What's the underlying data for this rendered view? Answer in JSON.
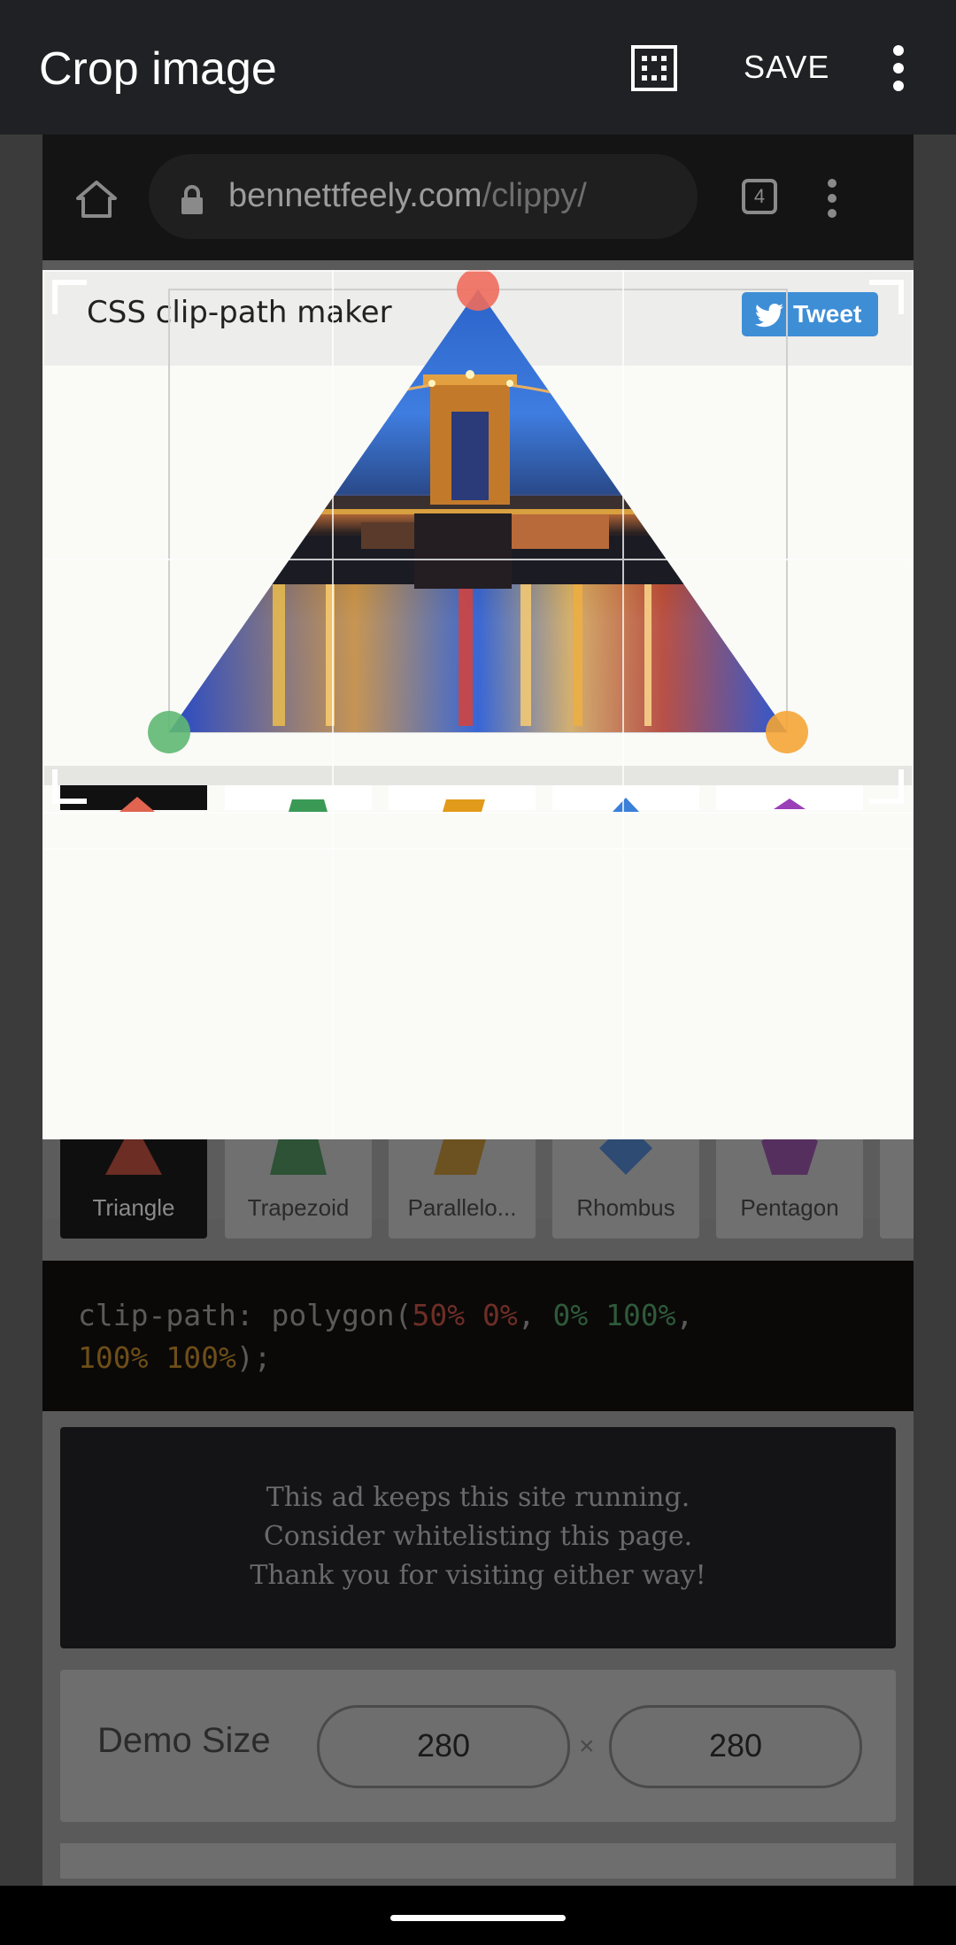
{
  "app_bar": {
    "title": "Crop image",
    "aspect_icon": "aspect-ratio-grid-icon",
    "save_label": "SAVE",
    "more_icon": "more-vert-icon"
  },
  "browser": {
    "home_icon": "home-icon",
    "lock_icon": "lock-icon",
    "url_host": "bennettfeely.com",
    "url_path": "/clippy/",
    "tab_count": "4",
    "menu_icon": "more-vert-icon"
  },
  "page": {
    "title": "CSS clip-path maker",
    "tweet_label": "Tweet",
    "shapes": [
      {
        "label": "Triangle",
        "color": "#e0644f",
        "active": true
      },
      {
        "label": "Trapezoid",
        "color": "#3a9a55"
      },
      {
        "label": "Parallelo...",
        "color": "#e29a1a"
      },
      {
        "label": "Rhombus",
        "color": "#3a7fd8"
      },
      {
        "label": "Pentagon",
        "color": "#9a3fb8"
      }
    ],
    "code": {
      "prefix": "clip-path: polygon(",
      "p1": "50% 0%",
      "sep1": ", ",
      "p2": "0% 100%",
      "sep2": ",",
      "p3": "100% 100%",
      "suffix": ");"
    },
    "ad_lines": [
      "This ad keeps this site running.",
      "Consider whitelisting this page.",
      "Thank you for visiting either way!"
    ],
    "demo_size": {
      "label": "Demo Size",
      "width": "280",
      "times": "×",
      "height": "280"
    }
  },
  "colors": {
    "handle_top": "#ee6b5c",
    "handle_left": "#5fb873",
    "handle_right": "#f4a535",
    "tweet_bg": "#3e8ed6"
  }
}
